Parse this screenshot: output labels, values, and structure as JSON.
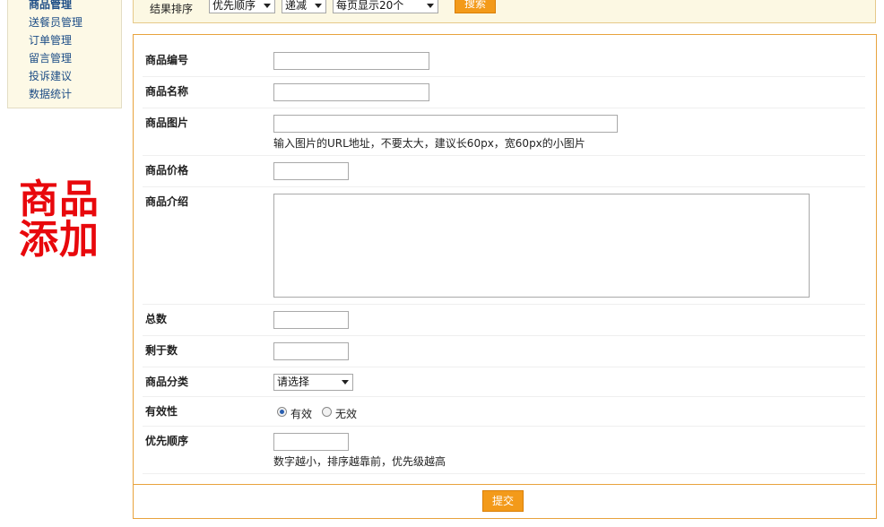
{
  "sidebar": {
    "items": [
      {
        "label": "商品管理"
      },
      {
        "label": "送餐员管理"
      },
      {
        "label": "订单管理"
      },
      {
        "label": "留言管理"
      },
      {
        "label": "投诉建议"
      },
      {
        "label": "数据统计"
      }
    ]
  },
  "page_title": {
    "line1": "商品",
    "line2": "添加"
  },
  "filter_bar": {
    "label": "结果排序",
    "sort_field": "优先顺序",
    "sort_order": "递减",
    "page_size": "每页显示20个",
    "search_label": "搜索"
  },
  "form": {
    "fields": {
      "product_id": {
        "label": "商品编号",
        "value": ""
      },
      "product_name": {
        "label": "商品名称",
        "value": ""
      },
      "product_image": {
        "label": "商品图片",
        "value": "",
        "hint": "输入图片的URL地址，不要太大，建议长60px，宽60px的小图片"
      },
      "product_price": {
        "label": "商品价格",
        "value": ""
      },
      "product_intro": {
        "label": "商品介绍",
        "value": ""
      },
      "total": {
        "label": "总数",
        "value": ""
      },
      "remaining": {
        "label": "剩于数",
        "value": ""
      },
      "category": {
        "label": "商品分类",
        "selected": "请选择"
      },
      "validity": {
        "label": "有效性",
        "options": [
          "有效",
          "无效"
        ],
        "selected": "有效"
      },
      "priority": {
        "label": "优先顺序",
        "value": "",
        "hint": "数字越小，排序越靠前，优先级越高"
      }
    },
    "submit_label": "提交"
  }
}
